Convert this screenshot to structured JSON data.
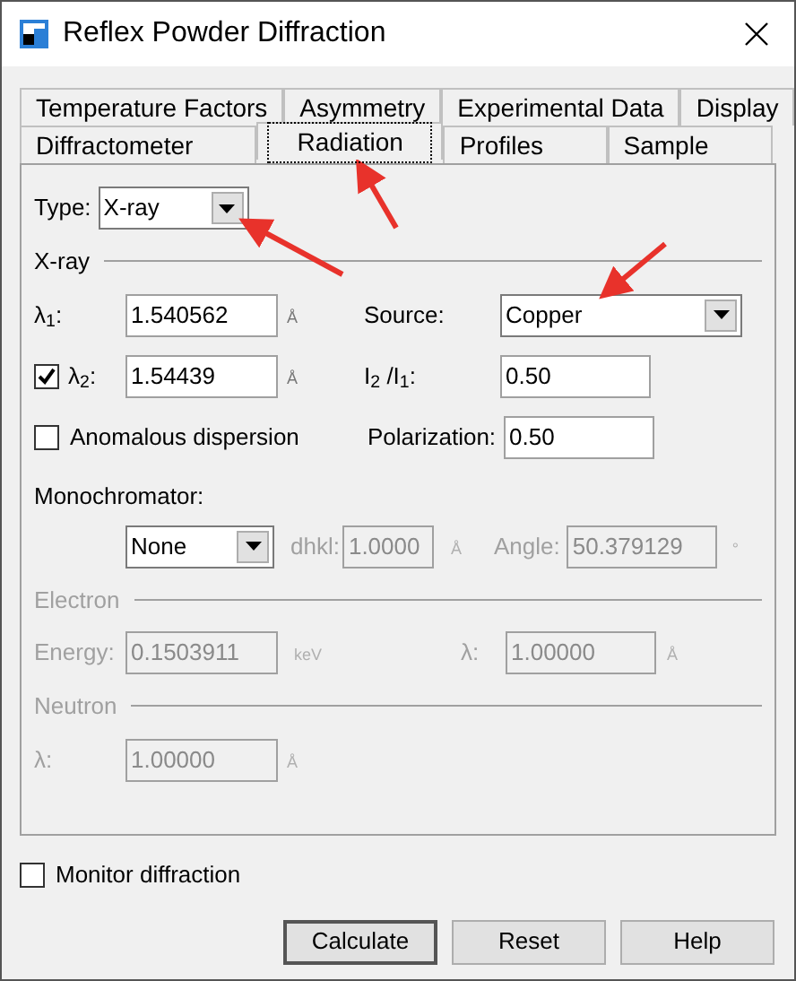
{
  "window": {
    "title": "Reflex Powder Diffraction"
  },
  "tab_rows": [
    {
      "tabs": [
        {
          "label": "Temperature Factors",
          "selected": false
        },
        {
          "label": "Asymmetry",
          "selected": false
        },
        {
          "label": "Experimental Data",
          "selected": false
        },
        {
          "label": "Display",
          "selected": false
        }
      ]
    },
    {
      "tabs": [
        {
          "label": "Diffractometer",
          "selected": false
        },
        {
          "label": "Radiation",
          "selected": true
        },
        {
          "label": "Profiles",
          "selected": false
        },
        {
          "label": "Sample",
          "selected": false
        }
      ]
    }
  ],
  "type": {
    "label": "Type:",
    "value": "X-ray"
  },
  "xray": {
    "heading": "X-ray",
    "lambda1": {
      "label": "λ$_{1}$:",
      "value": "1.540562",
      "unit": "Å"
    },
    "lambda2": {
      "label": "λ$_{2}$:",
      "value": "1.54439",
      "unit": "Å",
      "checked": true
    },
    "source": {
      "label": "Source:",
      "value": "Copper"
    },
    "ratio": {
      "label": "I$_{2}$ /I$_{1}$:",
      "value": "0.50"
    },
    "anomalous": {
      "label": "Anomalous dispersion",
      "checked": false
    },
    "polarization": {
      "label": "Polarization:",
      "value": "0.50"
    },
    "monochromator": {
      "label": "Monochromator:",
      "value": "None",
      "dhkl": {
        "label": "dhkl:",
        "value": "1.0000",
        "unit": "Å",
        "disabled": true
      },
      "angle": {
        "label": "Angle:",
        "value": "50.379129",
        "unit": "°",
        "disabled": true
      }
    }
  },
  "electron": {
    "heading": "Electron",
    "disabled": true,
    "energy": {
      "label": "Energy:",
      "value": "0.1503911",
      "unit": "keV"
    },
    "lambda": {
      "label": "λ:",
      "value": "1.00000",
      "unit": "Å"
    }
  },
  "neutron": {
    "heading": "Neutron",
    "disabled": true,
    "lambda": {
      "label": "λ:",
      "value": "1.00000",
      "unit": "Å"
    }
  },
  "monitor": {
    "label": "Monitor diffraction",
    "checked": false
  },
  "buttons": [
    {
      "label": "Calculate",
      "default": true
    },
    {
      "label": "Reset",
      "default": false
    },
    {
      "label": "Help",
      "default": false
    }
  ]
}
